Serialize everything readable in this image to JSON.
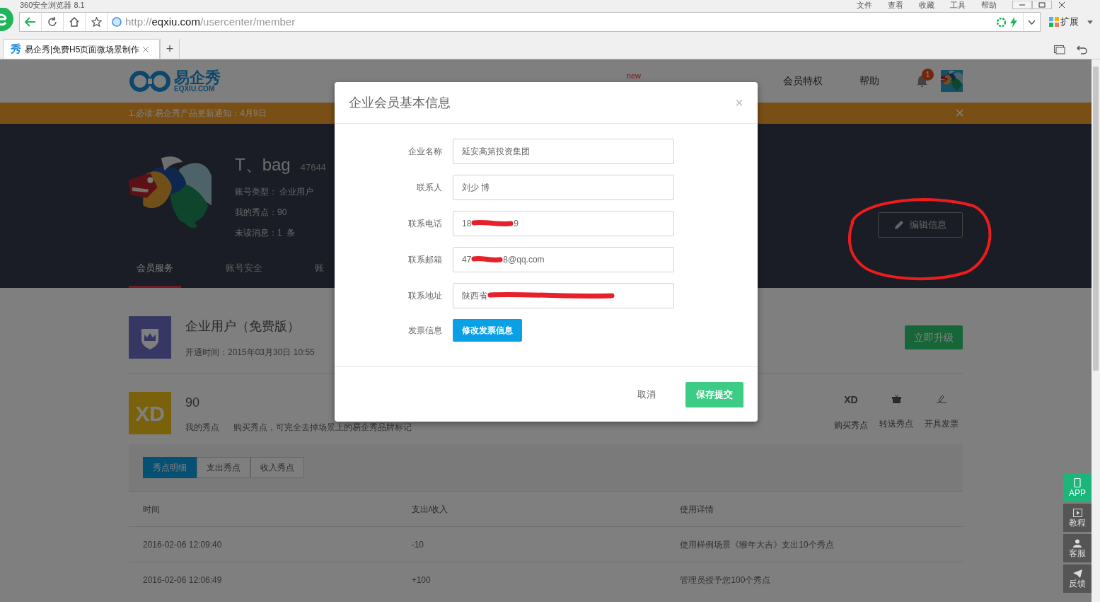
{
  "browser": {
    "title": "360安全浏览器 8.1",
    "menu": [
      "文件",
      "查看",
      "收藏",
      "工具",
      "帮助"
    ],
    "url": {
      "scheme": "http://",
      "host": "eqxiu.com",
      "path": "/usercenter/member"
    },
    "extensions_label": "扩展",
    "tabs": [
      {
        "favicon": "秀",
        "title": "易企秀|免费H5页面微场景制作",
        "selected": true
      }
    ],
    "new_tab": "+"
  },
  "header": {
    "logo": {
      "name": "易企秀",
      "domain": "EQXIU.COM"
    },
    "design_badge": "new",
    "nav": [
      {
        "label": "会员特权"
      },
      {
        "label": "帮助"
      }
    ],
    "notifications": "1"
  },
  "notice": {
    "text": "1.必读:易企秀产品更新通知：4月9日",
    "close": "×"
  },
  "profile": {
    "name": "T、bag",
    "id": "47644",
    "lines": [
      "账号类型： 企业用户",
      "我的秀点：90",
      "未读消息：1  条"
    ],
    "edit_button": "编辑信息",
    "tabs": [
      {
        "label": "会员服务",
        "selected": true
      },
      {
        "label": "账号安全",
        "selected": false
      },
      {
        "label": "账",
        "selected": false
      }
    ]
  },
  "membership": {
    "title": "企业用户（免费版）",
    "opened": "开通时间：2015年03月30日 10:55",
    "upgrade_button": "立即升级"
  },
  "points": {
    "icon_text": "XD",
    "amount": "90",
    "label": "我的秀点",
    "hint": "购买秀点，可完全去掉场景上的易企秀品牌标记",
    "actions": [
      {
        "kind": "buy",
        "icon_text": "XD",
        "label": "购买秀点"
      },
      {
        "kind": "gift",
        "label": "转送秀点"
      },
      {
        "kind": "invoice",
        "label": "开具发票"
      }
    ]
  },
  "history": {
    "tabs": [
      {
        "label": "秀点明细",
        "selected": true
      },
      {
        "label": "支出秀点",
        "selected": false
      },
      {
        "label": "收入秀点",
        "selected": false
      }
    ],
    "columns": [
      "时间",
      "支出/收入",
      "使用详情"
    ],
    "rows": [
      [
        "2016-02-06 12:09:40",
        "-10",
        "使用样例场景《猴年大吉》支出10个秀点"
      ],
      [
        "2016-02-06 12:06:49",
        "+100",
        "管理员授予您100个秀点"
      ]
    ]
  },
  "side_buttons": [
    {
      "kind": "app",
      "label": "APP"
    },
    {
      "kind": "tutorial",
      "label": "教程"
    },
    {
      "kind": "service",
      "label": "客服"
    },
    {
      "kind": "feedback",
      "label": "反馈"
    }
  ],
  "modal": {
    "title": "企业会员基本信息",
    "close": "×",
    "fields": [
      {
        "label": "企业名称",
        "redacted": false,
        "value": "延安高第投资集团"
      },
      {
        "label": "联系人",
        "redacted": false,
        "value": "刘少 博"
      },
      {
        "label": "联系电话",
        "redacted": true,
        "visible_start": "18",
        "visible_end": "9"
      },
      {
        "label": "联系邮箱",
        "redacted": true,
        "visible_start": "47",
        "visible_end": "8@qq.com"
      },
      {
        "label": "联系地址",
        "redacted": true,
        "visible_start": "陕西省"
      }
    ],
    "invoice": {
      "label": "发票信息",
      "button": "修改发票信息"
    },
    "cancel": "取消",
    "submit": "保存提交"
  },
  "annotation": {
    "kind": "circle"
  }
}
